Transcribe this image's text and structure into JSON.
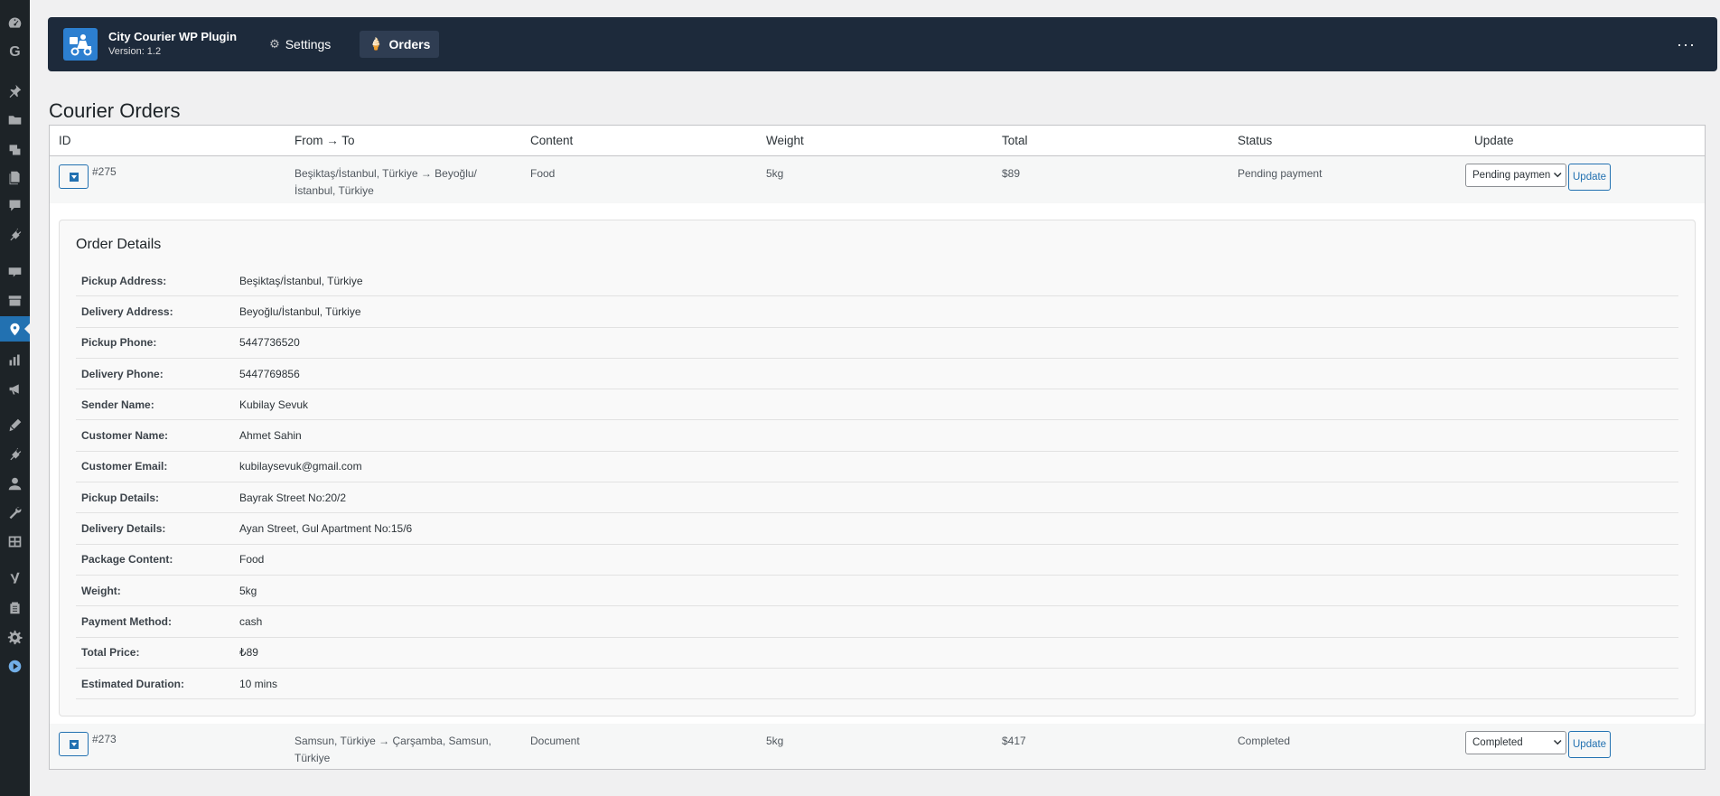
{
  "header": {
    "plugin_name": "City Courier WP Plugin",
    "version": "Version: 1.2",
    "tabs": [
      {
        "label": "Settings",
        "icon": "gear-icon"
      },
      {
        "label": "Orders",
        "icon": "order-icon",
        "active": true
      }
    ],
    "more_icon": "more-dots-icon"
  },
  "page": {
    "title": "Courier Orders"
  },
  "table": {
    "columns": [
      "ID",
      "From → To",
      "Content",
      "Weight",
      "Total",
      "Status",
      "Update"
    ],
    "orders": [
      {
        "id": "#275",
        "route": "Beşiktaş/İstanbul, Türkiye → Beyoğlu/ İstanbul, Türkiye",
        "content": "Food",
        "weight": "5kg",
        "total": "$89",
        "status": "Pending payment",
        "select_value": "Pending payment",
        "update_label": "Update"
      },
      {
        "id": "#273",
        "route": "Samsun, Türkiye → Çarşamba, Samsun, Türkiye",
        "content": "Document",
        "weight": "5kg",
        "total": "$417",
        "status": "Completed",
        "select_value": "Completed",
        "update_label": "Update"
      }
    ]
  },
  "details": {
    "title": "Order Details",
    "rows": [
      {
        "label": "Pickup Address:",
        "value": "Beşiktaş/İstanbul, Türkiye"
      },
      {
        "label": "Delivery Address:",
        "value": "Beyoğlu/İstanbul, Türkiye"
      },
      {
        "label": "Pickup Phone:",
        "value": "5447736520"
      },
      {
        "label": "Delivery Phone:",
        "value": "5447769856"
      },
      {
        "label": "Sender Name:",
        "value": "Kubilay Sevuk"
      },
      {
        "label": "Customer Name:",
        "value": "Ahmet Sahin"
      },
      {
        "label": "Customer Email:",
        "value": "kubilaysevuk@gmail.com"
      },
      {
        "label": "Pickup Details:",
        "value": "Bayrak Street No:20/2"
      },
      {
        "label": "Delivery Details:",
        "value": "Ayan Street, Gul Apartment No:15/6"
      },
      {
        "label": "Package Content:",
        "value": "Food"
      },
      {
        "label": "Weight:",
        "value": "5kg"
      },
      {
        "label": "Payment Method:",
        "value": "cash"
      },
      {
        "label": "Total Price:",
        "value": "₺89"
      },
      {
        "label": "Estimated Duration:",
        "value": "10 mins"
      }
    ]
  },
  "colors": {
    "header_bg": "#1d2a3b",
    "sidebar_bg": "#1d2327",
    "accent": "#2271b1"
  }
}
